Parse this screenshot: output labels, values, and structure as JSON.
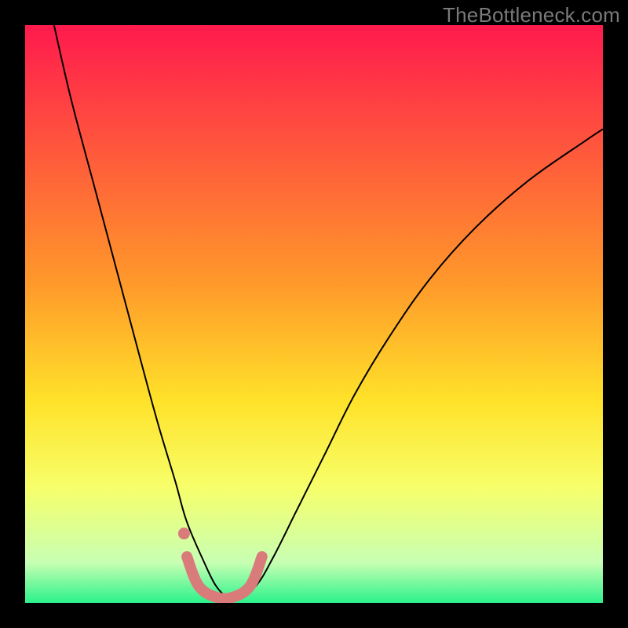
{
  "watermark": "TheBottleneck.com",
  "chart_data": {
    "type": "line",
    "title": "",
    "xlabel": "",
    "ylabel": "",
    "xlim": [
      0,
      100
    ],
    "ylim": [
      0,
      100
    ],
    "background_gradient": {
      "stops": [
        {
          "offset": 0,
          "color": "#ff1a4d"
        },
        {
          "offset": 45,
          "color": "#ff9a2a"
        },
        {
          "offset": 65,
          "color": "#ffe229"
        },
        {
          "offset": 80,
          "color": "#f7ff6a"
        },
        {
          "offset": 93,
          "color": "#c8ffb3"
        },
        {
          "offset": 100,
          "color": "#2bf28b"
        }
      ]
    },
    "series": [
      {
        "name": "bottleneck-curve",
        "color": "#000000",
        "x": [
          5,
          8,
          12,
          16,
          20,
          23,
          26,
          28,
          31,
          33,
          35,
          37,
          40,
          43,
          47,
          52,
          57,
          63,
          70,
          78,
          87,
          97,
          100
        ],
        "y": [
          100,
          87,
          72,
          57,
          42,
          31,
          21,
          14,
          7,
          3,
          1,
          1,
          3,
          8,
          16,
          26,
          36,
          46,
          56,
          65,
          73,
          80,
          82
        ]
      },
      {
        "name": "highlight-segment",
        "color": "#d97b7b",
        "stroke_width": 14,
        "x": [
          28,
          30,
          33,
          36,
          39,
          41
        ],
        "y": [
          8,
          3,
          1,
          1,
          3,
          8
        ]
      }
    ],
    "markers": [
      {
        "name": "highlight-dot",
        "x": 27.5,
        "y": 12,
        "r": 5,
        "color": "#d97b7b"
      }
    ]
  }
}
